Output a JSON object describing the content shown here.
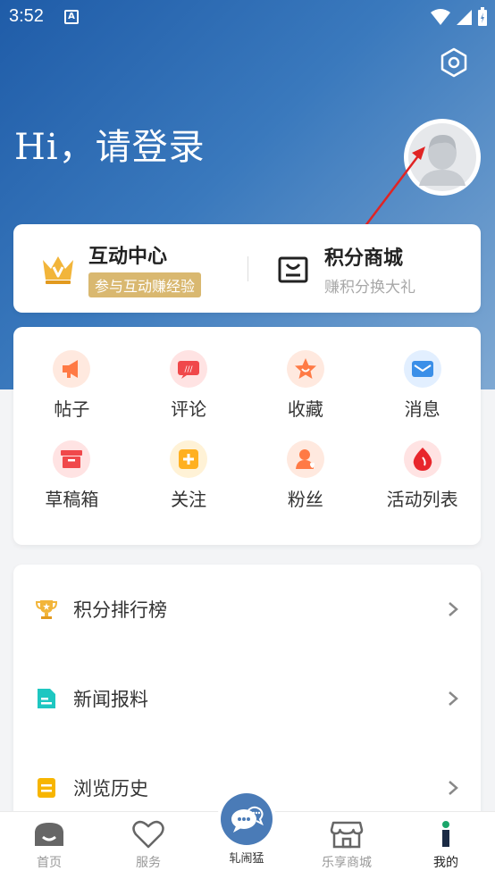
{
  "status": {
    "time": "3:52",
    "notif": "A"
  },
  "header": {
    "greeting": "Hi，请登录"
  },
  "top_card": {
    "left": {
      "title": "互动中心",
      "tag": "参与互动赚经验"
    },
    "right": {
      "title": "积分商城",
      "subtitle": "赚积分换大礼"
    }
  },
  "grid": [
    {
      "label": "帖子",
      "icon": "megaphone-icon",
      "color": "#ff7a45"
    },
    {
      "label": "评论",
      "icon": "comment-icon",
      "color": "#f0484b"
    },
    {
      "label": "收藏",
      "icon": "star-icon",
      "color": "#ff7a45"
    },
    {
      "label": "消息",
      "icon": "mail-icon",
      "color": "#3b8fe8"
    },
    {
      "label": "草稿箱",
      "icon": "drafts-box-icon",
      "color": "#f0484b"
    },
    {
      "label": "关注",
      "icon": "plus-icon",
      "color": "#ffb020"
    },
    {
      "label": "粉丝",
      "icon": "fans-icon",
      "color": "#ff7a45"
    },
    {
      "label": "活动列表",
      "icon": "activity-drop-icon",
      "color": "#e8262c"
    }
  ],
  "menu": [
    {
      "label": "积分排行榜",
      "icon": "trophy-icon"
    },
    {
      "label": "新闻报料",
      "icon": "news-doc-icon"
    },
    {
      "label": "浏览历史",
      "icon": "history-icon"
    }
  ],
  "tabs": {
    "home": "首页",
    "service": "服务",
    "center": "轧闹猛",
    "mall": "乐享商城",
    "mine": "我的"
  },
  "colors": {
    "accent": "#4a7bb7",
    "gold": "#d9b870"
  }
}
